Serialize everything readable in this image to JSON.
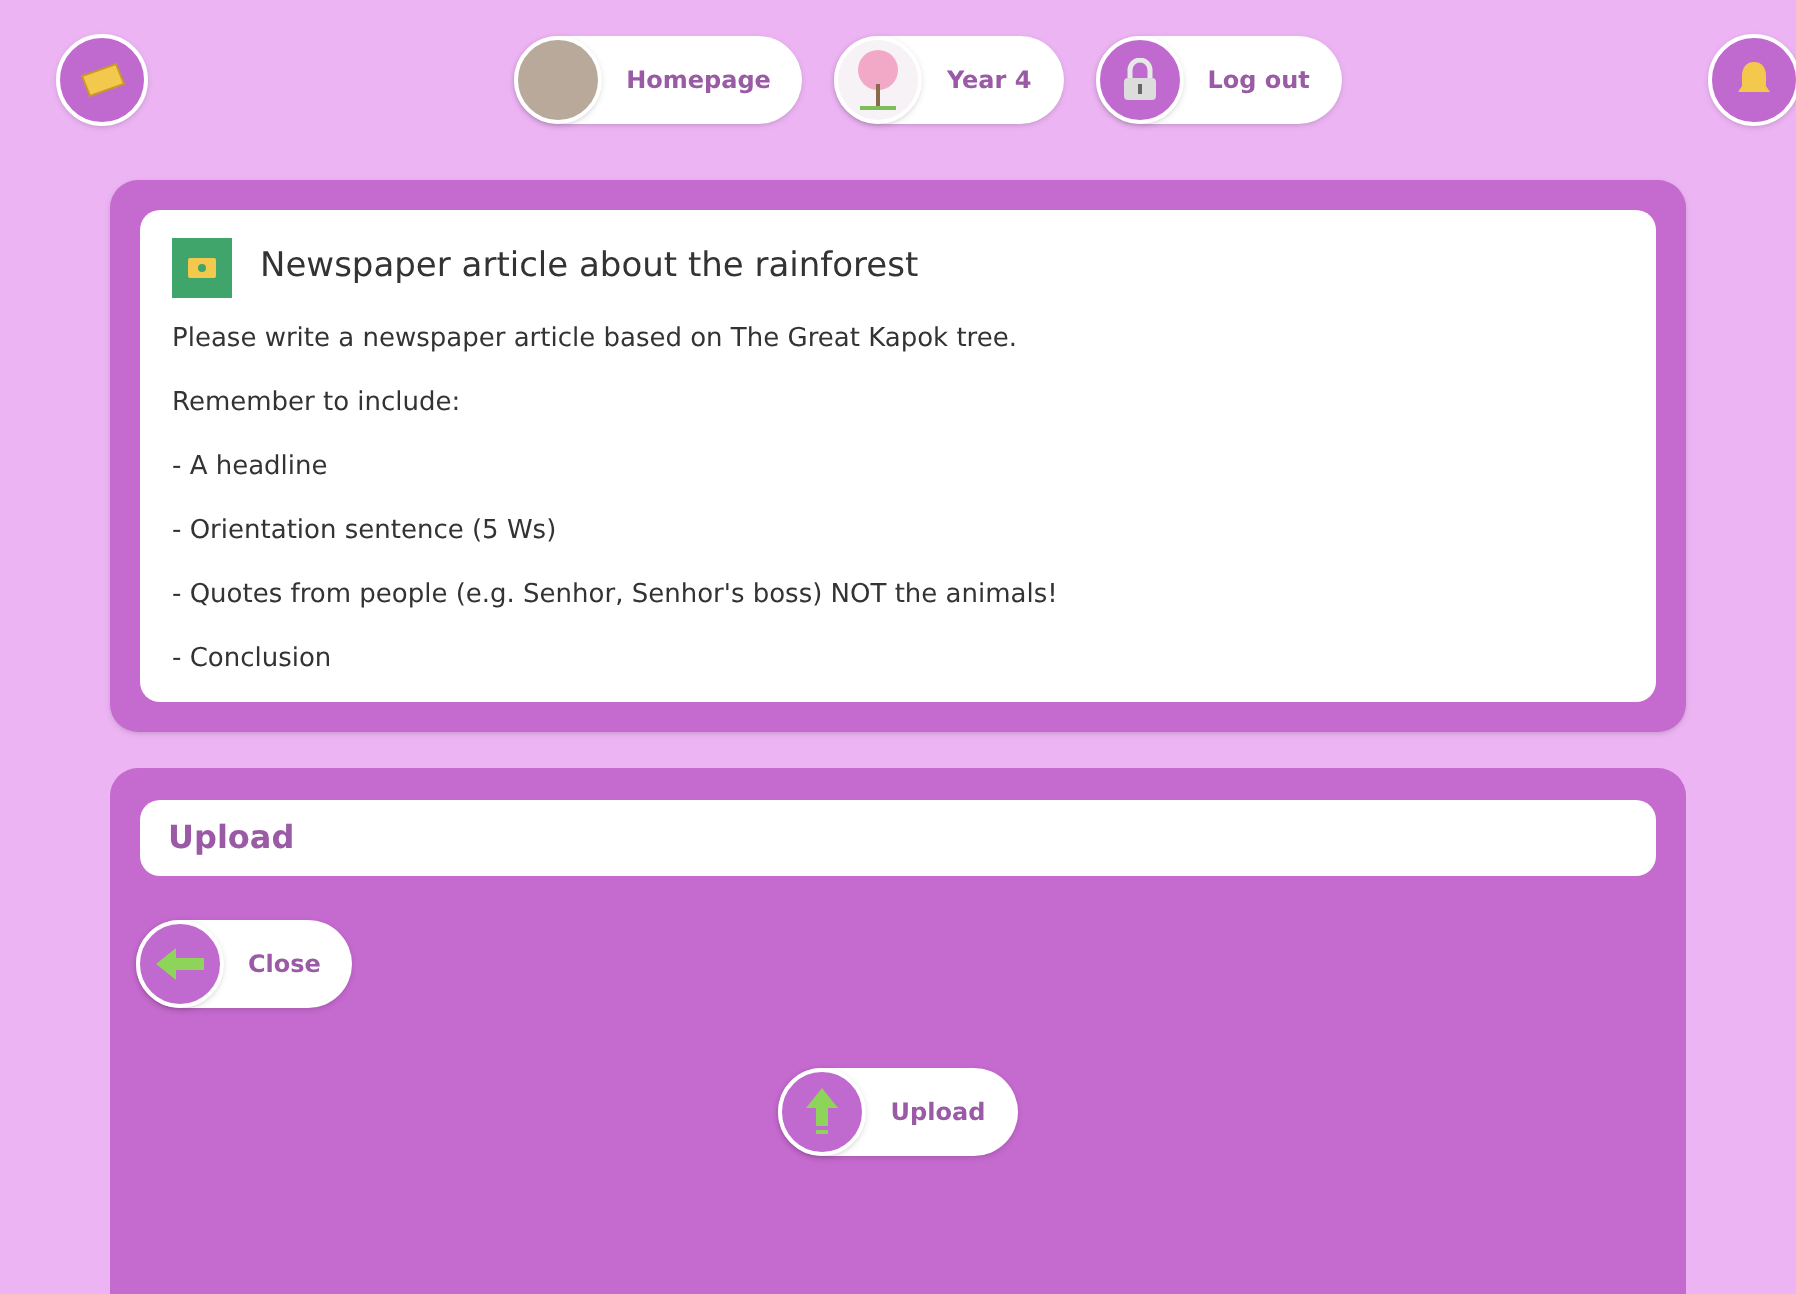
{
  "nav": [
    {
      "kind": "photo",
      "label": "Homepage"
    },
    {
      "kind": "tree",
      "label": "Year 4"
    },
    {
      "kind": "lock",
      "label": "Log out"
    }
  ],
  "task": {
    "title": "Newspaper article about the rainforest",
    "lines": [
      "Please write a newspaper article based on The Great Kapok tree.",
      "Remember to include:",
      "- A headline",
      "- Orientation sentence (5 Ws)",
      "- Quotes from people (e.g. Senhor, Senhor's boss) NOT the animals!",
      "- Conclusion"
    ]
  },
  "upload": {
    "heading": "Upload",
    "close": "Close",
    "button": "Upload"
  }
}
